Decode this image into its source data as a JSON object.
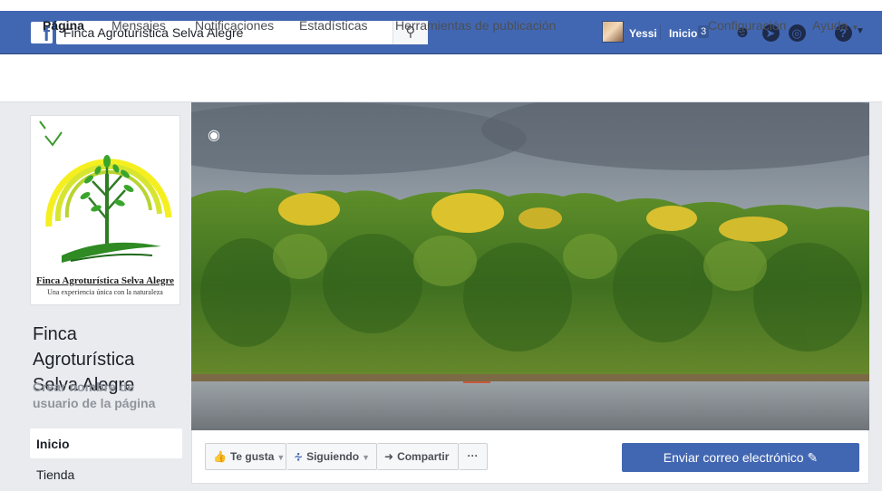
{
  "topbar": {
    "search_value": "Finca Agroturística Selva Alegre",
    "user_name": "Yessi",
    "home_label": "Inicio",
    "home_count": "3"
  },
  "pagenav": {
    "items": [
      "Página",
      "Mensajes",
      "Notificaciones",
      "Estadísticas",
      "Herramientas de publicación"
    ],
    "settings": "Configuración",
    "help": "Ayuda"
  },
  "profile": {
    "logo_title": "Finca Agroturística Selva Alegre",
    "logo_subtitle": "Una experiencia única con la naturaleza",
    "page_name": "Finca Agroturística Selva Alegre",
    "username_prompt": "Crear nombre de usuario de la página"
  },
  "sidebar": {
    "items": [
      "Inicio",
      "Tienda"
    ]
  },
  "actions": {
    "like": "Te gusta",
    "follow": "Siguiendo",
    "share": "Compartir",
    "more": "···",
    "email": "Enviar correo electrónico"
  },
  "colors": {
    "brand": "#4267b2",
    "background": "#e9ebee"
  }
}
